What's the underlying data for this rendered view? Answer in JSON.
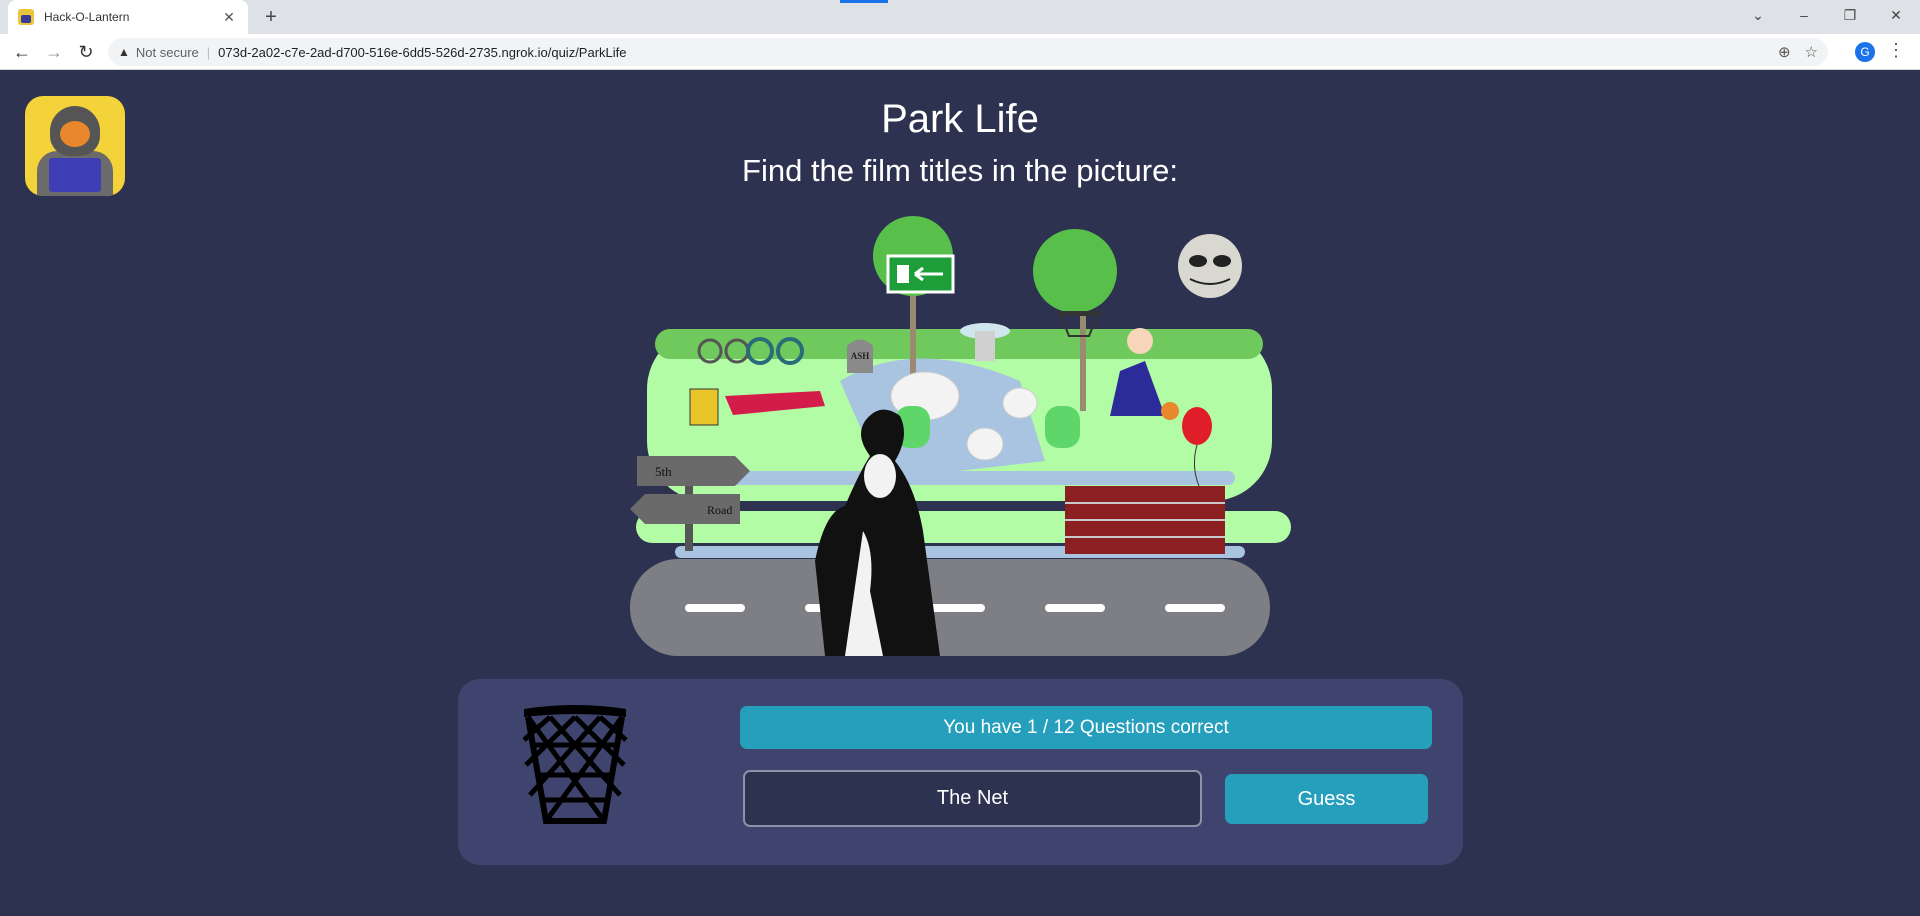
{
  "browser": {
    "tab_title": "Hack-O-Lantern",
    "tab_close": "✕",
    "new_tab": "+",
    "security_text": "Not secure",
    "url": "073d-2a02-c7e-2ad-d700-516e-6dd5-526d-2735.ngrok.io/quiz/ParkLife",
    "profile_initial": "G"
  },
  "page": {
    "title": "Park Life",
    "subtitle": "Find the film titles in the picture:"
  },
  "scene": {
    "exit_sign": "Exit",
    "gravestone_text": "ASH",
    "signpost_top": "5th",
    "signpost_bottom": "Road"
  },
  "quiz": {
    "score_text": "You have 1 / 12 Questions correct",
    "answer_value": "The Net",
    "guess_label": "Guess",
    "clue_icon": "basketball-net-icon"
  },
  "colors": {
    "background": "#2d3250",
    "panel": "#3e446e",
    "accent": "#269fbd"
  }
}
